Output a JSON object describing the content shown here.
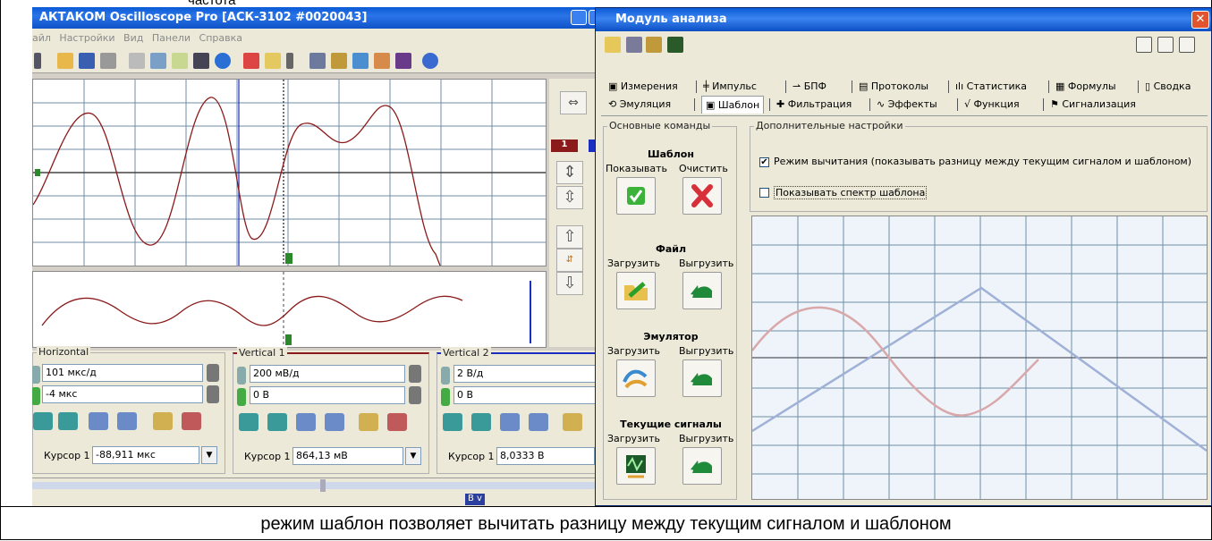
{
  "top_caption_fragment": "частота",
  "bottom_caption": "режим шаблон позволяет вычитать разницу между текущим сигналом и шаблоном",
  "oscilloscope": {
    "title": "АКТАКОМ Oscilloscope Pro [АСК-3102 #0020043]",
    "menu": [
      "айл",
      "Настройки",
      "Вид",
      "Панели",
      "Справка"
    ],
    "channel_badge": "1",
    "horizontal": {
      "label": "Horizontal",
      "timebase": "101 мкс/д",
      "offset": "-4 мкс",
      "cursor_label": "Курсор 1",
      "cursor_value": "-88,911 мкс"
    },
    "vertical1": {
      "label": "Vertical 1",
      "scale": "200 мВ/д",
      "offset": "0 В",
      "cursor_label": "Курсор 1",
      "cursor_value": "864,13 мВ"
    },
    "vertical2": {
      "label": "Vertical 2",
      "scale": "2 В/д",
      "offset": "0 В",
      "cursor_label": "Курсор 1",
      "cursor_value": "8,0333 В"
    },
    "status_tag": "B v"
  },
  "analysis": {
    "title": "Модуль анализа",
    "tabs_row1": [
      "Измерения",
      "Импульс",
      "БПФ",
      "Протоколы",
      "Статистика",
      "Формулы",
      "Сводка"
    ],
    "tabs_row2": [
      "Эмуляция",
      "Шаблон",
      "Фильтрация",
      "Эффекты",
      "Функция",
      "Сигнализация"
    ],
    "active_tab": "Шаблон",
    "basic_commands": {
      "label": "Основные команды",
      "template": {
        "heading": "Шаблон",
        "show": "Показывать",
        "clear": "Очистить"
      },
      "file": {
        "heading": "Файл",
        "load": "Загрузить",
        "unload": "Выгрузить"
      },
      "emulator": {
        "heading": "Эмулятор",
        "load": "Загрузить",
        "unload": "Выгрузить"
      },
      "current": {
        "heading": "Текущие сигналы",
        "load": "Загрузить",
        "unload": "Выгрузить"
      }
    },
    "extra_settings": {
      "label": "Дополнительные настройки",
      "subtract_mode": {
        "label": "Режим вычитания (показывать разницу между текущим сигналом и шаблоном)",
        "checked": true
      },
      "show_spectrum": {
        "label": "Показывать спектр шаблона",
        "checked": false
      }
    }
  },
  "colors": {
    "signal1": "#8b1a1a",
    "signal_pink": "#d9a8ab",
    "signal_blue": "#9fb1d6",
    "grid": "#6f8ea6"
  }
}
